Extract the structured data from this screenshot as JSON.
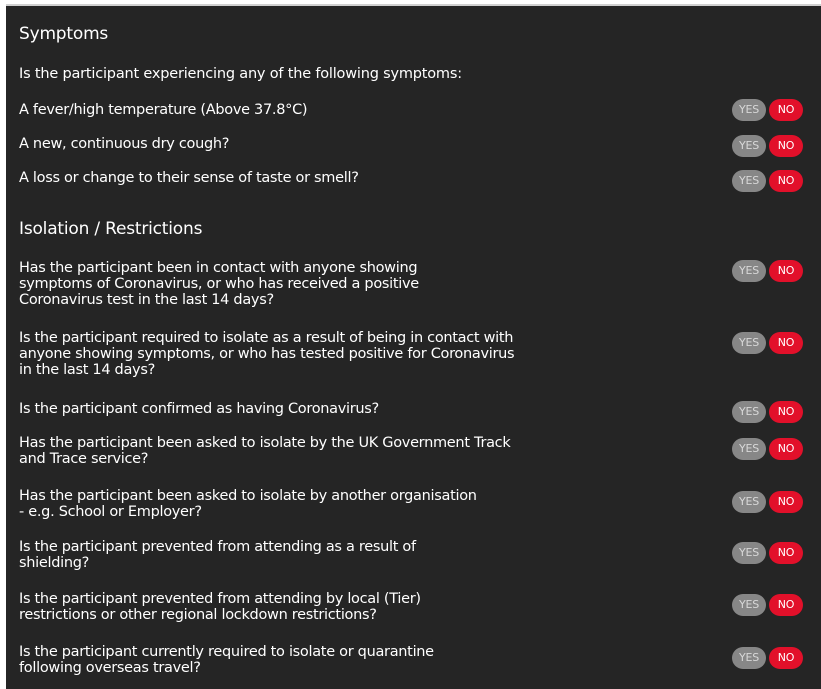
{
  "symptoms": {
    "title": "Symptoms",
    "intro": "Is the participant experiencing any of the following symptoms:",
    "questions": [
      {
        "text": "A fever/high temperature (Above 37.8°C)",
        "yes": "YES",
        "no": "NO",
        "selected": "NO"
      },
      {
        "text": "A new, continuous dry cough?",
        "yes": "YES",
        "no": "NO",
        "selected": "NO"
      },
      {
        "text": "A loss or change to their sense of taste or smell?",
        "yes": "YES",
        "no": "NO",
        "selected": "NO"
      }
    ]
  },
  "isolation": {
    "title": "Isolation / Restrictions",
    "questions": [
      {
        "text": "Has the participant been in contact with anyone showing symptoms of Coronavirus, or who has received a positive Coronavirus test in the last 14 days?",
        "yes": "YES",
        "no": "NO",
        "selected": "NO"
      },
      {
        "text": "Is the participant required to isolate as a result of being in contact with anyone showing symptoms, or who has tested positive for Coronavirus in the last 14 days?",
        "yes": "YES",
        "no": "NO",
        "selected": "NO"
      },
      {
        "text": "Is the participant confirmed as having Coronavirus?",
        "yes": "YES",
        "no": "NO",
        "selected": "NO"
      },
      {
        "text": "Has the participant been asked to isolate by the UK Government Track and Trace service?",
        "yes": "YES",
        "no": "NO",
        "selected": "NO"
      },
      {
        "text": "Has the participant been asked to isolate by another organisation - e.g. School or Employer?",
        "yes": "YES",
        "no": "NO",
        "selected": "NO"
      },
      {
        "text": "Is the participant prevented from attending as a result of shielding?",
        "yes": "YES",
        "no": "NO",
        "selected": "NO"
      },
      {
        "text": "Is the participant prevented from attending by local (Tier) restrictions or other regional lockdown restrictions?",
        "yes": "YES",
        "no": "NO",
        "selected": "NO"
      },
      {
        "text": "Is the participant currently required to isolate or quarantine following overseas travel?",
        "yes": "YES",
        "no": "NO",
        "selected": "NO"
      }
    ]
  },
  "colors": {
    "background": "#252525",
    "yes_pill": "#878787",
    "no_pill_selected": "#e2102a",
    "text": "#ffffff"
  }
}
